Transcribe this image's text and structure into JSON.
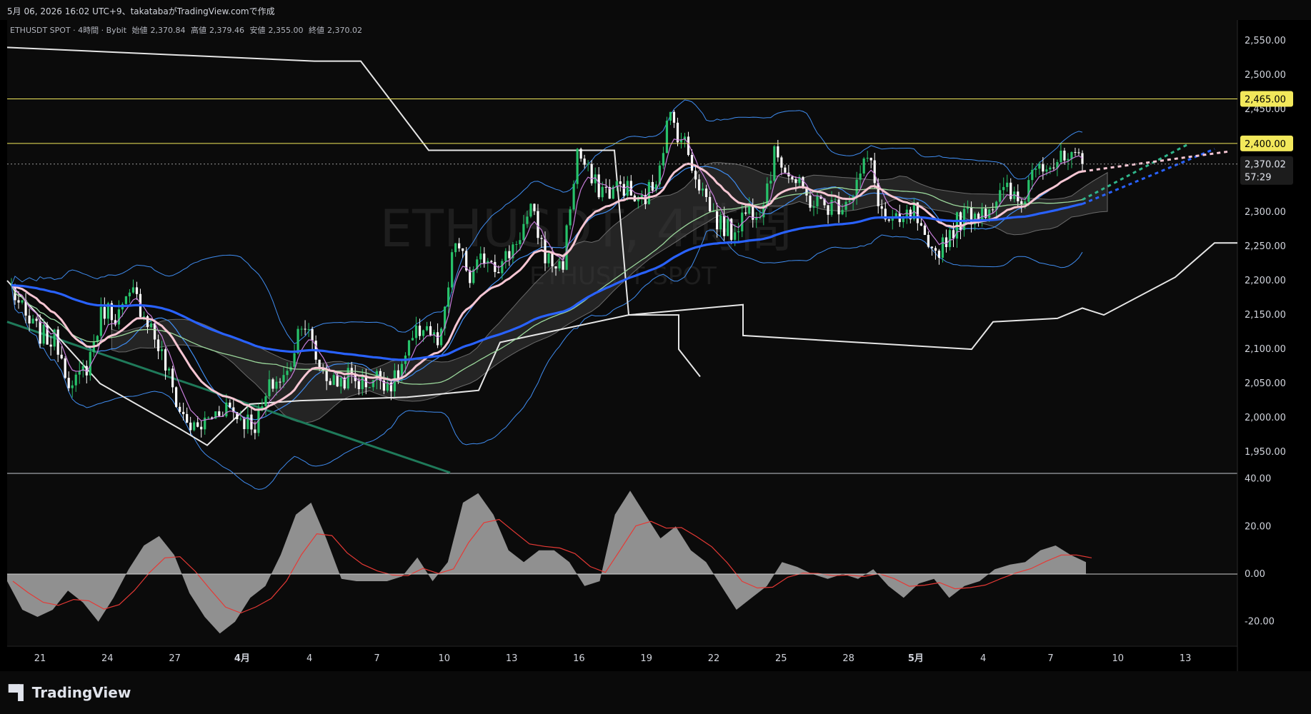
{
  "header": {
    "caption": "5月 06, 2026 16:02 UTC+9、takatabaがTradingView.comで作成"
  },
  "legend": {
    "symbol": "ETHUSDT SPOT · 4時間 · Bybit",
    "open_label": "始値",
    "open": "2,370.84",
    "high_label": "高値",
    "high": "2,379.46",
    "low_label": "安値",
    "low": "2,355.00",
    "close_label": "終値",
    "close": "2,370.02"
  },
  "watermark": {
    "main": "ETHUSDT, 4時間",
    "sub": "ETHUSDT SPOT"
  },
  "price_axis": {
    "ticks": [
      "2,550.00",
      "2,500.00",
      "2,450.00",
      "2,400.00",
      "2,350.00",
      "2,300.00",
      "2,250.00",
      "2,200.00",
      "2,150.00",
      "2,100.00",
      "2,050.00",
      "2,000.00",
      "1,950.00"
    ],
    "tick_values": [
      2550,
      2500,
      2450,
      2400,
      2350,
      2300,
      2250,
      2200,
      2150,
      2100,
      2050,
      2000,
      1950
    ],
    "badges": [
      {
        "label": "2,465.00",
        "value": 2465,
        "style": "yellow"
      },
      {
        "label": "2,400.00",
        "value": 2400,
        "style": "yellow"
      },
      {
        "label": "2,370.02",
        "value": 2370.02,
        "style": "dark"
      }
    ],
    "countdown": "57:29"
  },
  "osc_axis": {
    "ticks": [
      "40.00",
      "20.00",
      "0.00",
      "-20.00"
    ],
    "tick_values": [
      40,
      20,
      0,
      -20
    ]
  },
  "time_axis": {
    "labels": [
      "21",
      "24",
      "27",
      "4月",
      "4",
      "7",
      "10",
      "13",
      "16",
      "19",
      "22",
      "25",
      "28",
      "5月",
      "4",
      "7",
      "10",
      "13"
    ],
    "bold": [
      false,
      false,
      false,
      true,
      false,
      false,
      false,
      false,
      false,
      false,
      false,
      false,
      false,
      true,
      false,
      false,
      false,
      false
    ]
  },
  "chart_data": {
    "type": "candlestick",
    "ylim": [
      1920,
      2580
    ],
    "osc_ylim": [
      -30,
      42
    ],
    "horizontal_lines": [
      2465,
      2400
    ],
    "last_price": 2370.02,
    "ohlc_anchor_closes": [
      2190,
      2140,
      2120,
      2110,
      2040,
      2080,
      2160,
      2150,
      2180,
      2140,
      2080,
      2010,
      1980,
      2000,
      2020,
      2000,
      1990,
      2050,
      2060,
      2150,
      2080,
      2050,
      2060,
      2050,
      2060,
      2050,
      2100,
      2140,
      2100,
      2260,
      2200,
      2240,
      2220,
      2260,
      2300,
      2230,
      2220,
      2390,
      2340,
      2330,
      2340,
      2310,
      2340,
      2440,
      2400,
      2340,
      2290,
      2270,
      2300,
      2310,
      2390,
      2350,
      2320,
      2310,
      2310,
      2330,
      2380,
      2290,
      2280,
      2300,
      2230,
      2260,
      2290,
      2300,
      2310,
      2330,
      2310,
      2380,
      2370,
      2375,
      2370
    ],
    "volume_oscillator": [
      -3,
      -15,
      -18,
      -15,
      -7,
      -12,
      -20,
      -10,
      2,
      12,
      16,
      8,
      -8,
      -18,
      -25,
      -20,
      -10,
      -5,
      8,
      25,
      30,
      15,
      -2,
      -3,
      -3,
      -3,
      -1,
      7,
      -3,
      5,
      30,
      34,
      25,
      10,
      5,
      10,
      10,
      5,
      -5,
      -3,
      25,
      35,
      25,
      15,
      20,
      10,
      5,
      -5,
      -15,
      -10,
      -5,
      5,
      3,
      0,
      -2,
      0,
      -2,
      2,
      -5,
      -10,
      -4,
      -2,
      -10,
      -5,
      -3,
      2,
      4,
      5,
      10,
      12,
      8,
      5
    ],
    "series": [
      {
        "name": "",
        "role": "ema_pink"
      },
      {
        "name": "",
        "role": "ema_blue"
      },
      {
        "name": "",
        "role": "sma_green"
      },
      {
        "name": "",
        "role": "bollinger"
      },
      {
        "name": "",
        "role": "ichimoku_cloud"
      },
      {
        "name": "",
        "role": "white_trail"
      }
    ]
  },
  "brand": {
    "name": "TradingView"
  },
  "colors": {
    "up": "#27c26a",
    "down": "#ffffff",
    "pink": "#f7c6d3",
    "blue": "#2962ff",
    "green_ma": "#9bd79b",
    "bb": "#3f8cf0",
    "yellow": "#f2e85b",
    "white_line": "#e6e6e6",
    "osc_fill": "#9e9e9e",
    "osc_signal": "#e53935"
  }
}
